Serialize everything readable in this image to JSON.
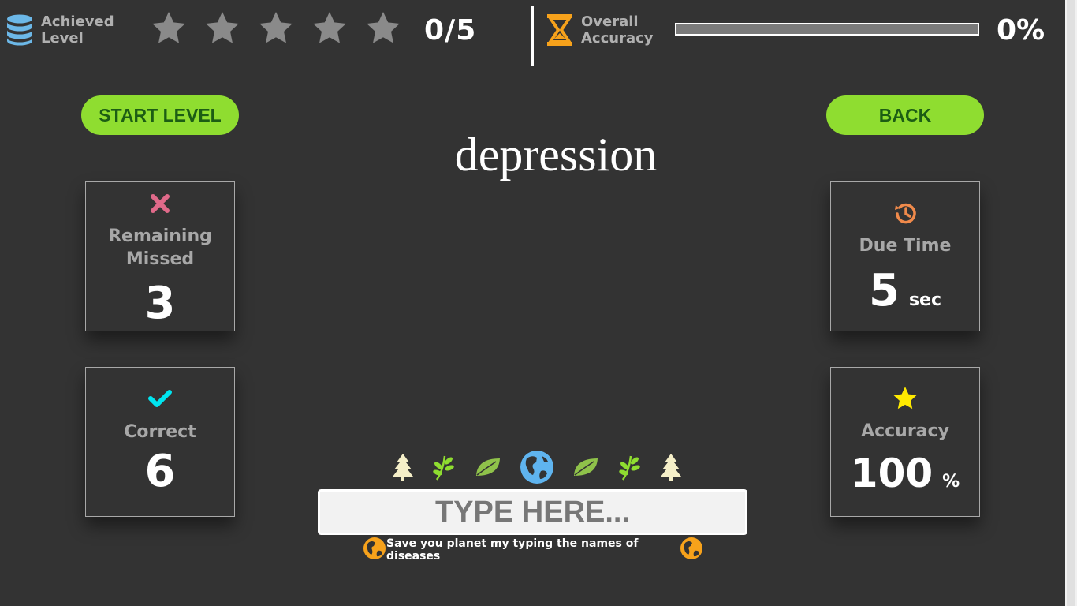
{
  "header": {
    "achieved_level_label": "Achieved\nLevel",
    "stars_total": 5,
    "stars_filled": 0,
    "score_text": "0/5",
    "overall_accuracy_label": "Overall\nAccuracy",
    "accuracy_progress": 0,
    "accuracy_percent_text": "0%"
  },
  "buttons": {
    "start_label": "START LEVEL",
    "back_label": "BACK"
  },
  "current_word": "depression",
  "stats": {
    "remaining_missed": {
      "label": "Remaining\nMissed",
      "value": "3"
    },
    "correct": {
      "label": "Correct",
      "value": "6"
    },
    "due_time": {
      "label": "Due Time",
      "value": "5",
      "unit": "sec"
    },
    "accuracy": {
      "label": "Accuracy",
      "value": "100",
      "unit": "%"
    }
  },
  "input": {
    "placeholder": "TYPE HERE...",
    "value": ""
  },
  "footer": {
    "tagline": "Save you planet my typing the names of diseases"
  },
  "colors": {
    "background": "#333333",
    "accent_green": "#8fdd30",
    "button_text": "#1c5d14",
    "missed_icon": "#e06a8a",
    "correct_icon": "#00e5f0",
    "clock_icon": "#f08a4b",
    "star_icon": "#ffea00",
    "hourglass": "#f7a21b",
    "database_icon": "#6cb8e8"
  },
  "icons": {
    "header": [
      "database-icon",
      "star-icon",
      "hourglass-icon"
    ],
    "cards": [
      "close-x-icon",
      "checkmark-icon",
      "history-clock-icon",
      "star-icon"
    ],
    "decorations": [
      "pine-tree-icon",
      "herb-icon",
      "leaf-icon",
      "earth-icon",
      "leaf-icon",
      "herb-icon",
      "pine-tree-icon"
    ]
  }
}
